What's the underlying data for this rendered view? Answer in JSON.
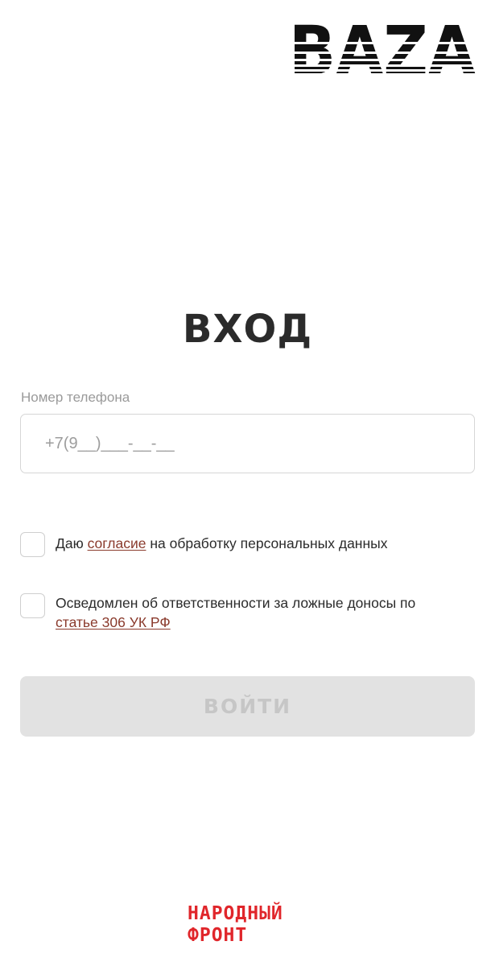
{
  "header": {
    "logo_text": "BAZA"
  },
  "login": {
    "title": "ВХОД",
    "phone_label": "Номер телефона",
    "phone_placeholder": "+7(9__)___-__-__",
    "consent": {
      "prefix": "Даю ",
      "link": "согласие",
      "suffix": " на обработку персональных данных"
    },
    "liability": {
      "text": "Осведомлен об ответственности за ложные доносы по ",
      "link": "статье 306 УК РФ"
    },
    "submit_label": "ВОЙТИ"
  },
  "footer": {
    "logo_line1": "НАРОДНЫЙ",
    "logo_line2": "ФРОНТ"
  },
  "colors": {
    "text": "#2b2b2b",
    "link": "#8a3a2c",
    "button_bg": "#e2e2e2",
    "button_text": "#c6c6c6",
    "footer_logo": "#e0262b"
  }
}
